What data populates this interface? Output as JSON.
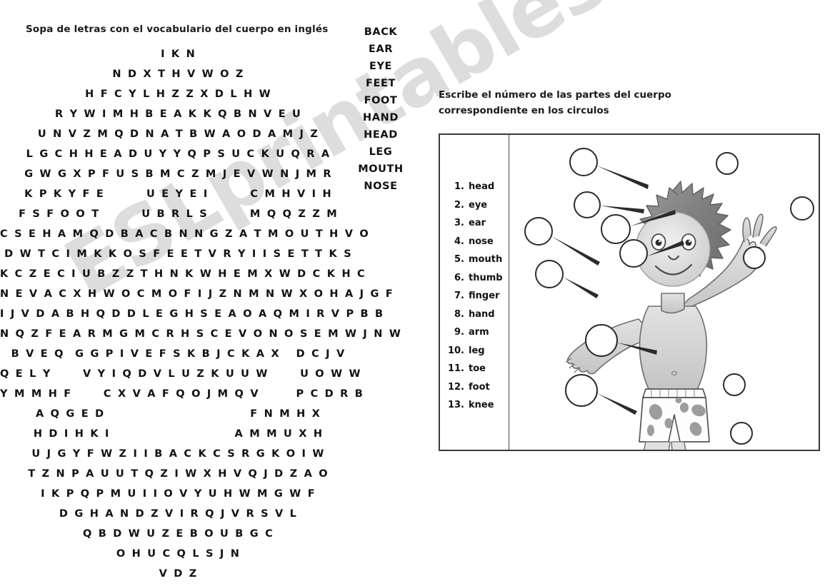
{
  "worksheet": {
    "title": "Sopa de letras con el vocabulario del cuerpo en inglés",
    "watermark": "ESLprintables.com"
  },
  "word_search": {
    "rows": [
      "I K N",
      "N D X T H V W O Z",
      "H F C Y L H Z Z X D L H W",
      "R Y W I M H B E A K K Q B N V E U",
      "U N V Z M Q D N A T B W A O D A M J Z",
      "L G C H H E A D U Y Y Q P S U C K U Q R A",
      "G W G X P F U S B M C Z M J E V W N J M R",
      "K P K Y F E        U E Y E I        C M H V I H",
      "F S F O O T        U B R L S        M Q Q Z Z M",
      "C S E H A M Q D B A C B N N G Z A T M O U T H V O",
      "D W T C I M K K O S F E E T V R Y I I S E T T K S",
      "K C Z E C I U B Z Z T H N K W H E M X W D C K H C",
      "N E V A C X H W O C M O F I J Z N M N W X O H A J G F",
      "I J V D A B H Q D D L E G H S E A O A Q M I R V P B B",
      "N Q Z F E A R M G M C R H S C E V O N O S E M W J N W",
      "B V E Q  G G P I V E F S K B J C K A X   D C J V",
      "Q E L Y      V Y I Q D V L U Z K U U W      U O W W",
      "Y M M H F      C X V A F Q O J M Q V       P C D R B",
      "A Q G E D                            F N M H X",
      "H D I H K I                        A M M U X H",
      "U J G Y F W Z I I B A C K C S R G K O I W",
      "T Z N P A U U T Q Z I W X H V Q J D Z A O",
      "I K P Q P M U I I O V Y U H W M G W F",
      "D G H A N D Z V I R Q J V R S V L",
      "Q B D W U Z E B O U B G C",
      "O H U C Q L S J N",
      "V D Z"
    ]
  },
  "word_list": {
    "words": [
      "BACK",
      "EAR",
      "EYE",
      "FEET",
      "FOOT",
      "HAND",
      "HEAD",
      "LEG",
      "MOUTH",
      "NOSE"
    ]
  },
  "labeling_exercise": {
    "instruction_line1": "Escribe el número de las partes del cuerpo",
    "instruction_line2": "correspondiente en los circulos",
    "body_parts": [
      {
        "num": "1.",
        "name": "head"
      },
      {
        "num": "2.",
        "name": "eye"
      },
      {
        "num": "3.",
        "name": "ear"
      },
      {
        "num": "4.",
        "name": "nose"
      },
      {
        "num": "5.",
        "name": "mouth"
      },
      {
        "num": "6.",
        "name": "thumb"
      },
      {
        "num": "7.",
        "name": "finger"
      },
      {
        "num": "8.",
        "name": "hand"
      },
      {
        "num": "9.",
        "name": "arm"
      },
      {
        "num": "10.",
        "name": "leg"
      },
      {
        "num": "11.",
        "name": "toe"
      },
      {
        "num": "12.",
        "name": "foot"
      },
      {
        "num": "13.",
        "name": "knee"
      }
    ],
    "answer_circles_count": 13
  },
  "colors": {
    "ink": "#111111",
    "border": "#3a3a3a",
    "watermark": "#c9c9c9",
    "skin": "#d8d8d8",
    "hair": "#8a8a8a"
  }
}
